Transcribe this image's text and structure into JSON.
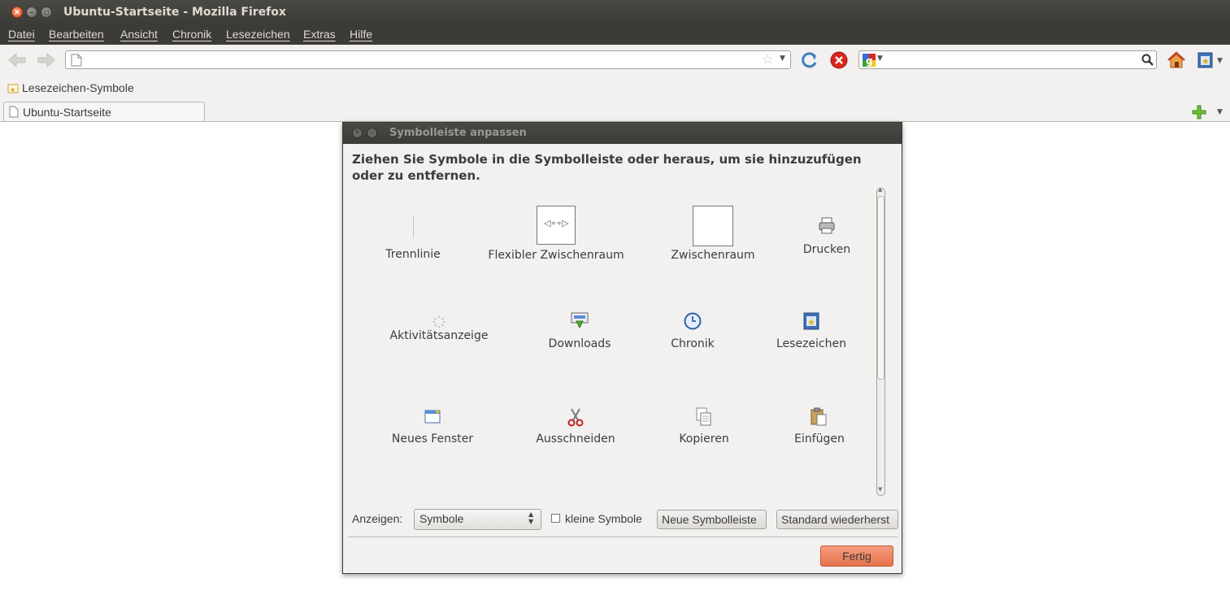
{
  "window": {
    "title": "Ubuntu-Startseite - Mozilla Firefox"
  },
  "menubar": {
    "items": [
      "Datei",
      "Bearbeiten",
      "Ansicht",
      "Chronik",
      "Lesezeichen",
      "Extras",
      "Hilfe"
    ]
  },
  "navbar": {
    "url_value": "",
    "search_value": ""
  },
  "bookmarks_toolbar": {
    "label": "Lesezeichen-Symbole"
  },
  "tabs": [
    {
      "label": "Ubuntu-Startseite"
    }
  ],
  "dialog": {
    "title": "Symbolleiste anpassen",
    "heading": "Ziehen Sie Symbole in die Symbolleiste oder heraus, um sie hinzuzufügen oder zu entfernen.",
    "items": [
      {
        "label": "Trennlinie",
        "icon": "separator-icon"
      },
      {
        "label": "Flexibler Zwischenraum",
        "icon": "flexible-space-icon"
      },
      {
        "label": "Zwischenraum",
        "icon": "space-icon"
      },
      {
        "label": "Drucken",
        "icon": "printer-icon"
      },
      {
        "label": "Aktivitätsanzeige",
        "icon": "throbber-icon"
      },
      {
        "label": "Downloads",
        "icon": "downloads-icon"
      },
      {
        "label": "Chronik",
        "icon": "clock-icon"
      },
      {
        "label": "Lesezeichen",
        "icon": "bookmarks-star-icon"
      },
      {
        "label": "Neues Fenster",
        "icon": "new-window-icon"
      },
      {
        "label": "Ausschneiden",
        "icon": "scissors-icon"
      },
      {
        "label": "Kopieren",
        "icon": "copy-icon"
      },
      {
        "label": "Einfügen",
        "icon": "paste-icon"
      }
    ],
    "show_label": "Anzeigen:",
    "show_value": "Symbole",
    "small_icons_label": "kleine Symbole",
    "small_icons_checked": false,
    "new_toolbar_label": "Neue Symbolleiste",
    "restore_label": "Standard wiederherst",
    "done_label": "Fertig"
  },
  "colors": {
    "titlebar": "#3c3b37",
    "accent": "#e5734c",
    "close": "#df4a16"
  }
}
